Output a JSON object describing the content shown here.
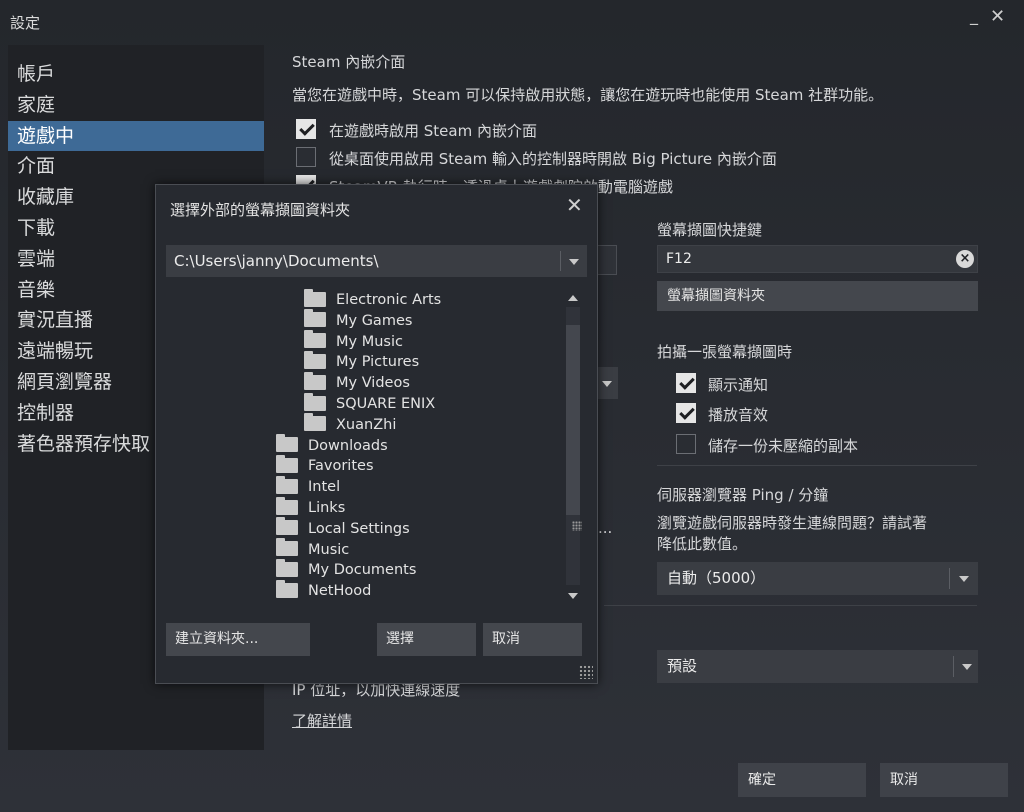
{
  "window": {
    "title": "設定",
    "minimize_label": "_",
    "close_label": "✕"
  },
  "sidebar": {
    "items": [
      {
        "label": "帳戶"
      },
      {
        "label": "家庭"
      },
      {
        "label": "遊戲中",
        "active": true
      },
      {
        "label": "介面"
      },
      {
        "label": "收藏庫"
      },
      {
        "label": "下載"
      },
      {
        "label": "雲端"
      },
      {
        "label": "音樂"
      },
      {
        "label": "實況直播"
      },
      {
        "label": "遠端暢玩"
      },
      {
        "label": "網頁瀏覽器"
      },
      {
        "label": "控制器"
      },
      {
        "label": "著色器預存快取"
      }
    ]
  },
  "content": {
    "overlay_heading": "Steam 內嵌介面",
    "overlay_desc": "當您在遊戲中時，Steam 可以保持啟用狀態，讓您在遊玩時也能使用 Steam 社群功能。",
    "checkbox_overlay": {
      "label": "在遊戲時啟用 Steam 內嵌介面",
      "checked": true
    },
    "checkbox_bigpicture": {
      "label": "從桌面使用啟用 Steam 輸入的控制器時開啟 Big Picture 內嵌介面",
      "checked": false
    },
    "checkbox_steamvr": {
      "label": "SteamVR 執行時，透過桌上遊戲劇院啟動電腦遊戲",
      "checked": true
    },
    "screenshot_hotkey_label": "螢幕擷圖快捷鍵",
    "screenshot_hotkey_value": "F12",
    "screenshot_folder_button": "螢幕擷圖資料夾",
    "when_screenshot_label": "拍攝一張螢幕擷圖時",
    "checkbox_notify": {
      "label": "顯示通知",
      "checked": true
    },
    "checkbox_sound": {
      "label": "播放音效",
      "checked": true
    },
    "checkbox_uncompressed": {
      "label": "儲存一份未壓縮的副本",
      "checked": false
    },
    "server_ping_label": "伺服器瀏覽器 Ping / 分鐘",
    "server_ping_desc_1": "瀏覽遊戲伺服器時發生連線問題？請試著",
    "server_ping_desc_2": "降低此數值。",
    "server_ping_value": "自動（5000）",
    "network_value": "預設",
    "ip_desc_tail": "IP 位址，以加快連線速度",
    "learn_more": "了解詳情",
    "partial_ellipsis": "..."
  },
  "footer": {
    "ok_label": "確定",
    "cancel_label": "取消"
  },
  "dialog": {
    "title": "選擇外部的螢幕擷圖資料夾",
    "close_label": "✕",
    "path": "C:\\Users\\janny\\Documents\\",
    "tree": [
      {
        "label": "Electronic Arts",
        "level": 2
      },
      {
        "label": "My Games",
        "level": 2
      },
      {
        "label": "My Music",
        "level": 2
      },
      {
        "label": "My Pictures",
        "level": 2
      },
      {
        "label": "My Videos",
        "level": 2
      },
      {
        "label": "SQUARE ENIX",
        "level": 2
      },
      {
        "label": "XuanZhi",
        "level": 2
      },
      {
        "label": "Downloads",
        "level": 1
      },
      {
        "label": "Favorites",
        "level": 1
      },
      {
        "label": "Intel",
        "level": 1
      },
      {
        "label": "Links",
        "level": 1
      },
      {
        "label": "Local Settings",
        "level": 1
      },
      {
        "label": "Music",
        "level": 1
      },
      {
        "label": "My Documents",
        "level": 1
      },
      {
        "label": "NetHood",
        "level": 1
      }
    ],
    "new_folder_label": "建立資料夾...",
    "select_label": "選擇",
    "cancel_label": "取消"
  }
}
